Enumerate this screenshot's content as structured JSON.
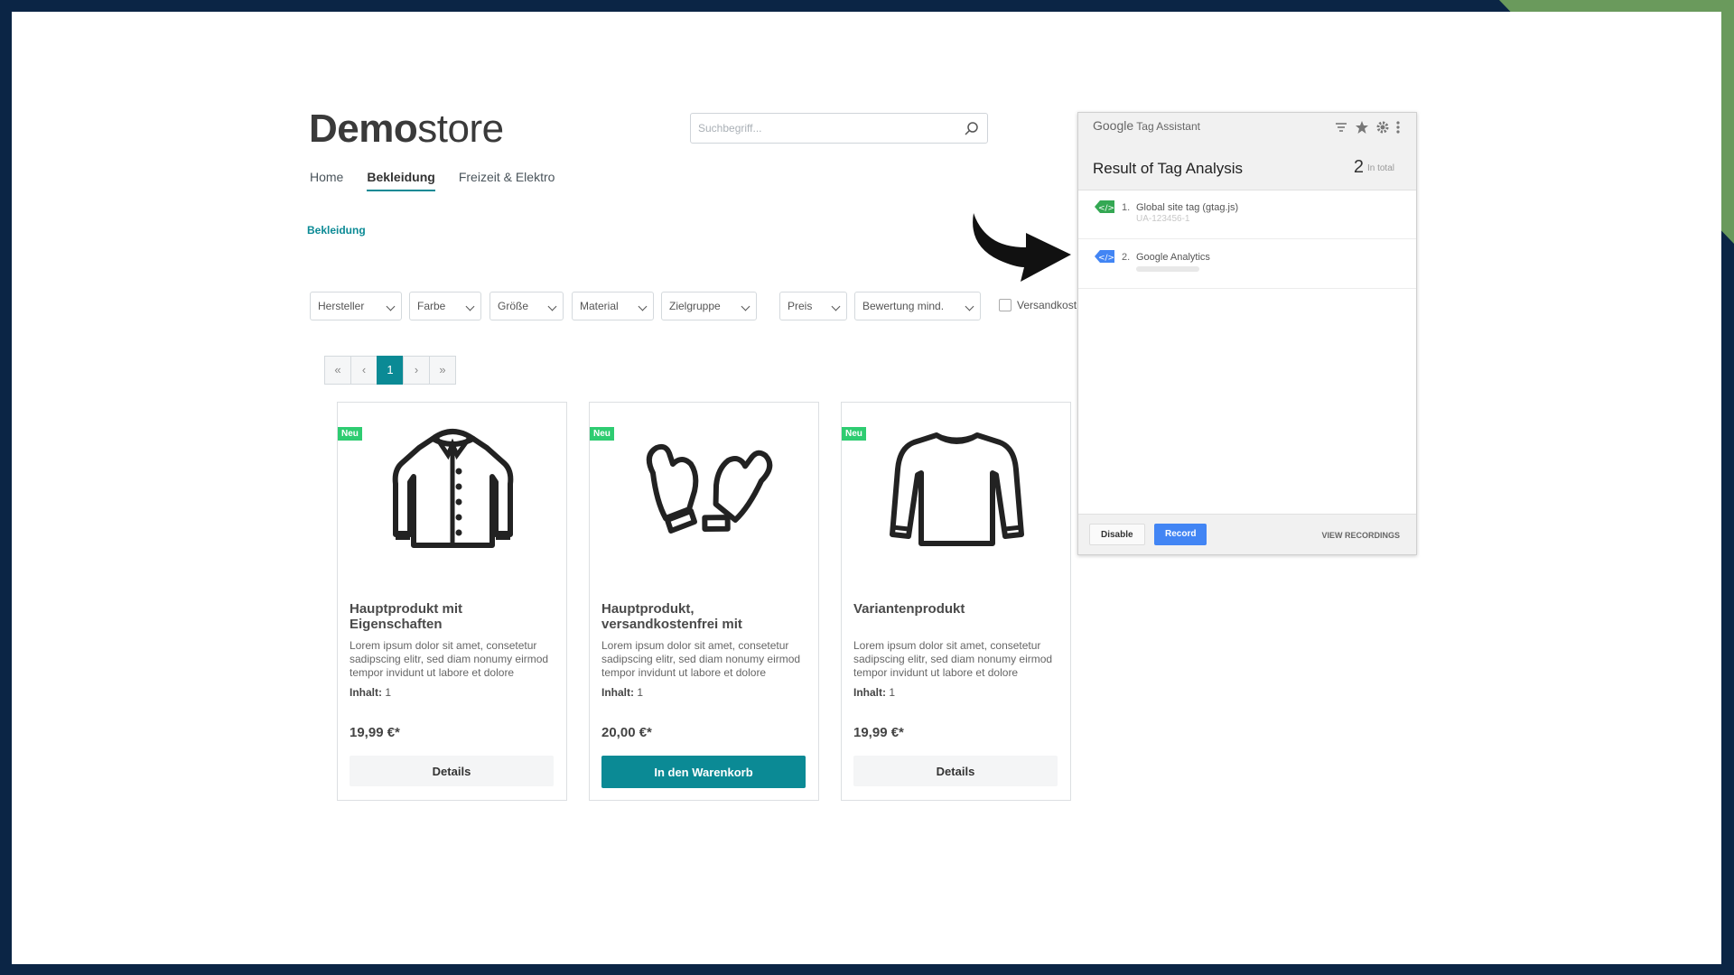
{
  "shop": {
    "logo_bold": "Demo",
    "logo_light": "store",
    "search_placeholder": "Suchbegriff...",
    "nav": [
      "Home",
      "Bekleidung",
      "Freizeit & Elektro"
    ],
    "breadcrumb": "Bekleidung",
    "filters": [
      "Hersteller",
      "Farbe",
      "Größe",
      "Material",
      "Zielgruppe",
      "Preis",
      "Bewertung mind."
    ],
    "filter_checkbox": "Versandkost",
    "pagination": [
      "«",
      "‹",
      "1",
      "›",
      "»"
    ],
    "products": [
      {
        "badge": "Neu",
        "title": "Hauptprodukt mit Eigenschaften",
        "description": "Lorem ipsum dolor sit amet, consetetur sadipscing elitr, sed diam nonumy eirmod tempor invidunt ut labore et dolore",
        "content_label": "Inhalt:",
        "content_value": "1",
        "price": "19,99 €*",
        "button": "Details",
        "icon": "jacket-icon"
      },
      {
        "badge": "Neu",
        "title": "Hauptprodukt, versandkostenfrei mit",
        "description": "Lorem ipsum dolor sit amet, consetetur sadipscing elitr, sed diam nonumy eirmod tempor invidunt ut labore et dolore",
        "content_label": "Inhalt:",
        "content_value": "1",
        "price": "20,00 €*",
        "button": "In den Warenkorb",
        "icon": "mittens-icon"
      },
      {
        "badge": "Neu",
        "title": "Variantenprodukt",
        "description": "Lorem ipsum dolor sit amet, consetetur sadipscing elitr, sed diam nonumy eirmod tempor invidunt ut labore et dolore",
        "content_label": "Inhalt:",
        "content_value": "1",
        "price": "19,99 €*",
        "button": "Details",
        "icon": "sweater-icon"
      }
    ]
  },
  "tag_assistant": {
    "brand_google": "Google",
    "brand_name": "Tag Assistant",
    "heading": "Result of Tag Analysis",
    "count": "2",
    "count_label": "In total",
    "tags": [
      {
        "num": "1.",
        "name": "Global site tag (gtag.js)",
        "sub": "UA-123456-1",
        "tag_color": "#34a853"
      },
      {
        "num": "2.",
        "name": "Google Analytics",
        "sub": "",
        "tag_color": "#4285f4"
      }
    ],
    "disable_label": "Disable",
    "record_label": "Record",
    "view_label": "VIEW RECORDINGS"
  },
  "colors": {
    "accent": "#0b8a95",
    "badge": "#2ecc71",
    "frame": "#0b2545",
    "corner": "#6a9a5c",
    "record": "#4285f4"
  }
}
